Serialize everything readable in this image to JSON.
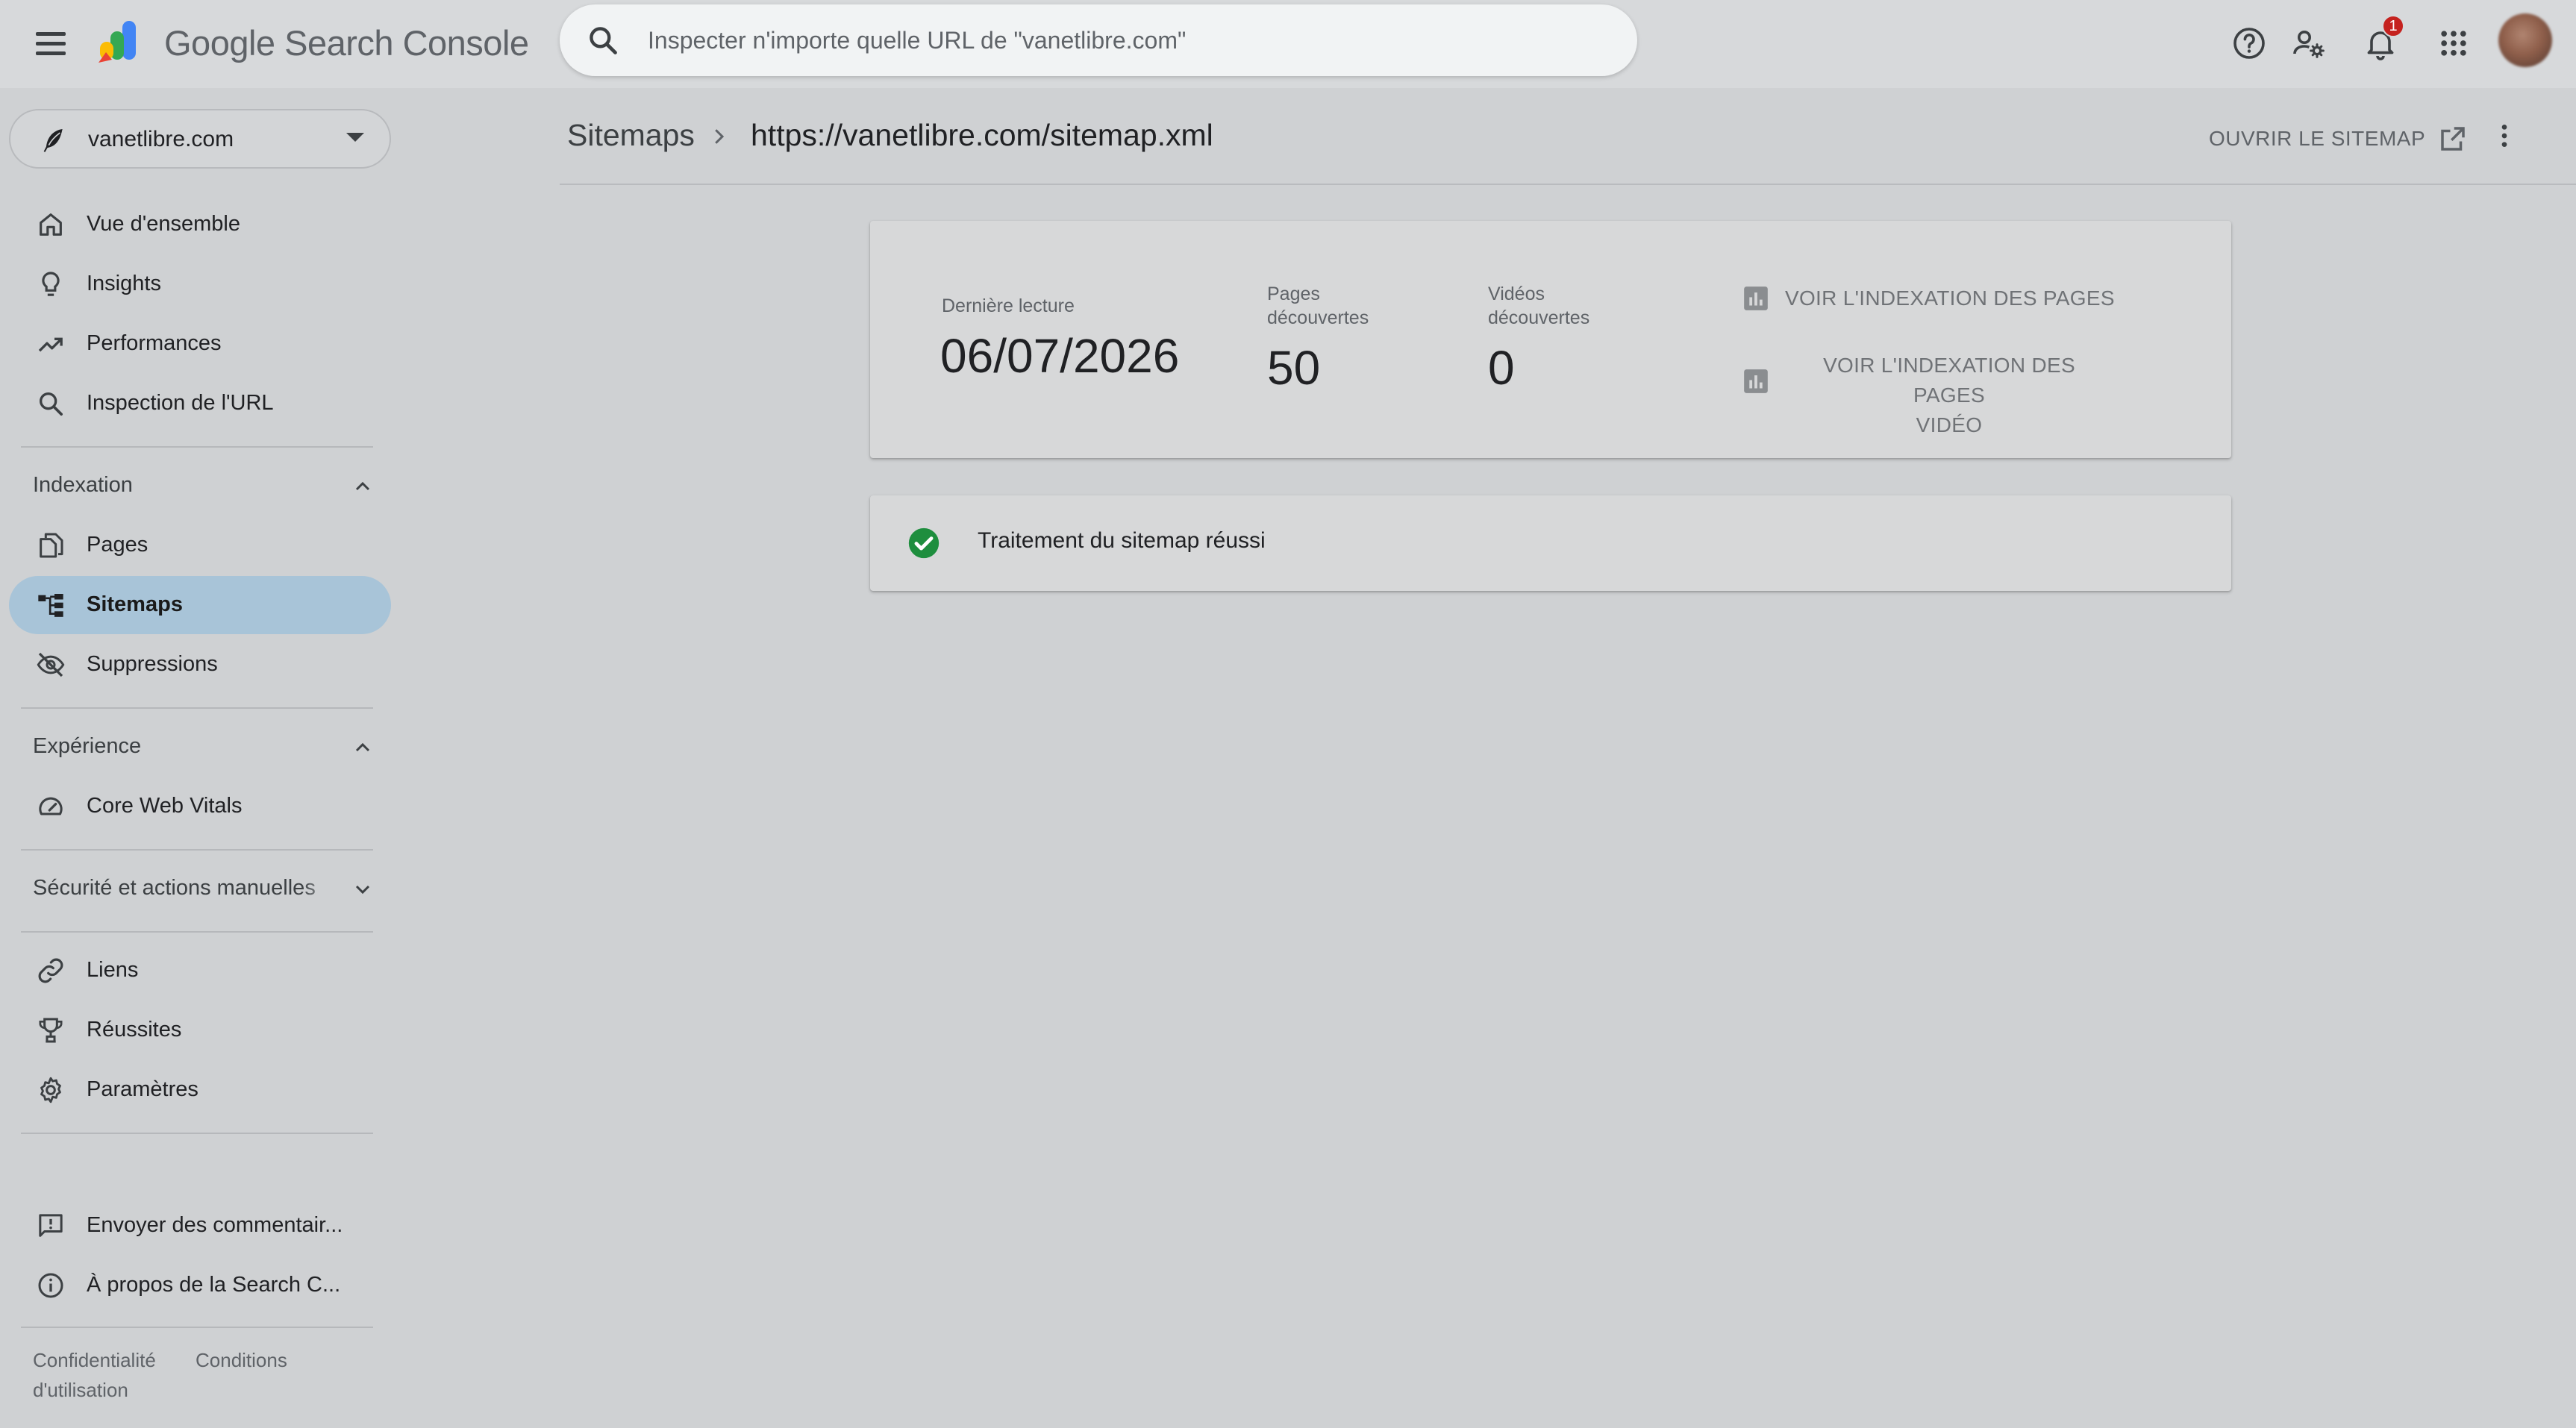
{
  "app": {
    "brand": "Google Search Console"
  },
  "search": {
    "placeholder": "Inspecter n'importe quelle URL de \"vanetlibre.com\""
  },
  "header": {
    "notification_count": "1"
  },
  "property": {
    "name": "vanetlibre.com"
  },
  "sidebar": {
    "items": [
      {
        "label": "Vue d'ensemble",
        "icon": "home-icon"
      },
      {
        "label": "Insights",
        "icon": "lightbulb-icon"
      },
      {
        "label": "Performances",
        "icon": "trending-up-icon"
      },
      {
        "label": "Inspection de l'URL",
        "icon": "search-icon"
      }
    ],
    "sections": [
      {
        "label": "Indexation",
        "expanded": true,
        "items": [
          {
            "label": "Pages",
            "icon": "pages-icon"
          },
          {
            "label": "Sitemaps",
            "icon": "sitemap-icon",
            "active": true
          },
          {
            "label": "Suppressions",
            "icon": "eye-off-icon"
          }
        ]
      },
      {
        "label": "Expérience",
        "expanded": true,
        "items": [
          {
            "label": "Core Web Vitals",
            "icon": "speed-icon"
          }
        ]
      },
      {
        "label": "Sécurité et actions manuelles",
        "expanded": false,
        "items": []
      }
    ],
    "bottom_items": [
      {
        "label": "Liens",
        "icon": "link-icon"
      },
      {
        "label": "Réussites",
        "icon": "trophy-icon"
      },
      {
        "label": "Paramètres",
        "icon": "gear-icon"
      }
    ],
    "extra_items": [
      {
        "label": "Envoyer des commentair...",
        "icon": "feedback-icon"
      },
      {
        "label": "À propos de la Search C...",
        "icon": "info-icon"
      }
    ],
    "footer": {
      "privacy": "Confidentialité",
      "terms_line1": "Conditions",
      "terms_line2": "d'utilisation"
    }
  },
  "breadcrumb": {
    "parent": "Sitemaps",
    "current": "https://vanetlibre.com/sitemap.xml"
  },
  "actions": {
    "open_sitemap": "OUVRIR LE SITEMAP"
  },
  "stats": {
    "last_read_label": "Dernière lecture",
    "last_read_value": "06/07/2026",
    "pages_label_line1": "Pages",
    "pages_label_line2": "découvertes",
    "pages_value": "50",
    "videos_label_line1": "Vidéos",
    "videos_label_line2": "découvertes",
    "videos_value": "0",
    "view_pages_link": "VOIR L'INDEXATION DES PAGES",
    "view_video_link_line1": "VOIR L'INDEXATION DES PAGES",
    "view_video_link_line2": "VIDÉO"
  },
  "status": {
    "message": "Traitement du sitemap réussi",
    "color": "#1e8e3e"
  }
}
